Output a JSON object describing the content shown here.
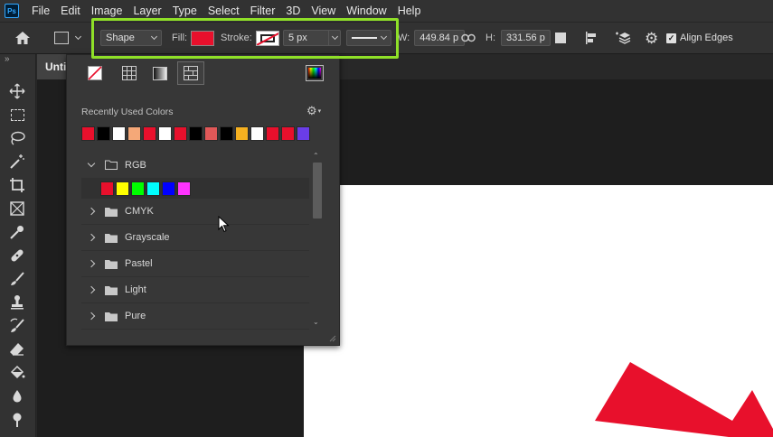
{
  "app": {
    "logo": "Ps"
  },
  "menu": [
    "File",
    "Edit",
    "Image",
    "Layer",
    "Type",
    "Select",
    "Filter",
    "3D",
    "View",
    "Window",
    "Help"
  ],
  "options": {
    "mode": "Shape",
    "fill_label": "Fill:",
    "fill_color": "#e8102c",
    "stroke_label": "Stroke:",
    "stroke_width": "5 px",
    "w_label": "W:",
    "w_value": "449.84 p",
    "h_label": "H:",
    "h_value": "331.56 p",
    "align_edges_label": "Align Edges",
    "align_edges_checked": true,
    "highlight_color": "#8fe028"
  },
  "document": {
    "tab_label": "Untitled"
  },
  "swatches": {
    "recent_label": "Recently Used Colors",
    "recent_colors": [
      "#e8102c",
      "#000000",
      "#ffffff",
      "#f5a878",
      "#e8102c",
      "#ffffff",
      "#e8102c",
      "#000000",
      "#e05858",
      "#000000",
      "#f5b020",
      "#ffffff",
      "#e8102c",
      "#e8102c",
      "#6a3de8"
    ],
    "groups": [
      {
        "label": "RGB",
        "expanded": true,
        "colors": [
          "#e8102c",
          "#ffff00",
          "#00ff00",
          "#00ffff",
          "#0000ff",
          "#ff33ff"
        ]
      },
      {
        "label": "CMYK",
        "expanded": false
      },
      {
        "label": "Grayscale",
        "expanded": false
      },
      {
        "label": "Pastel",
        "expanded": false
      },
      {
        "label": "Light",
        "expanded": false
      },
      {
        "label": "Pure",
        "expanded": false
      }
    ]
  },
  "colors": {
    "shape_fill": "#e8102c",
    "panel_bg": "#373737",
    "chrome_bg": "#323232"
  }
}
